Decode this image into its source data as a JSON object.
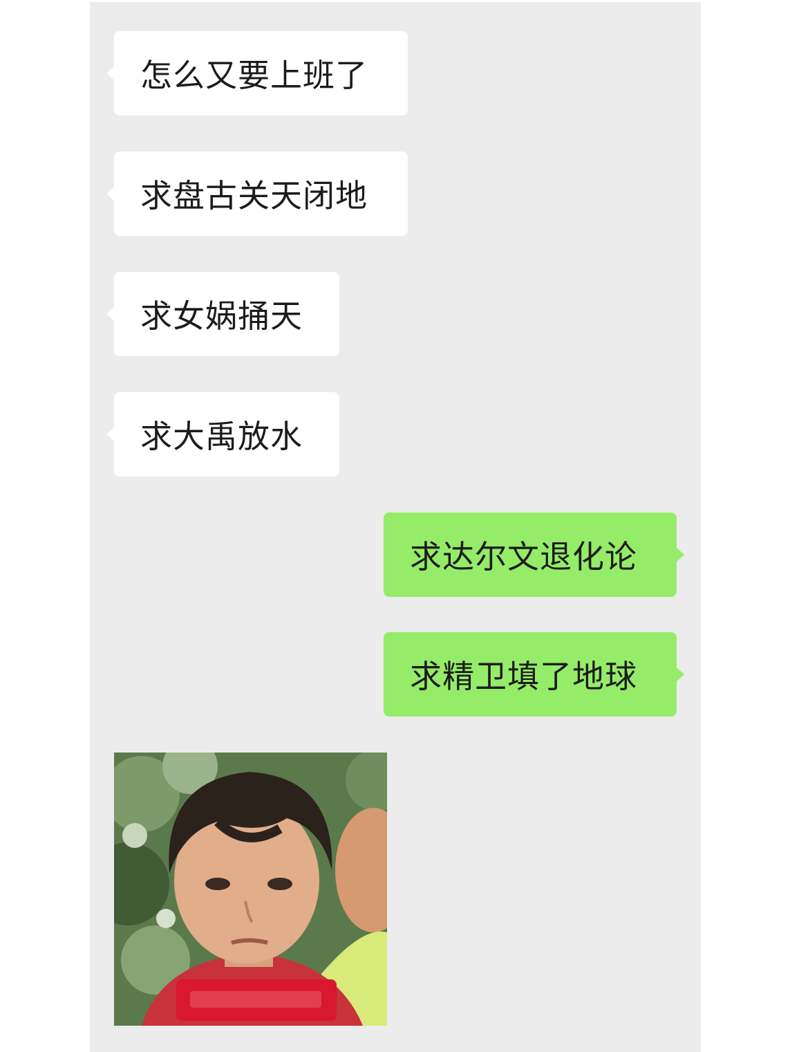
{
  "messages": [
    {
      "side": "incoming",
      "text": "怎么又要上班了"
    },
    {
      "side": "incoming",
      "text": "求盘古关天闭地"
    },
    {
      "side": "incoming",
      "text": "求女娲捅天"
    },
    {
      "side": "incoming",
      "text": "求大禹放水"
    },
    {
      "side": "outgoing",
      "text": "求达尔文退化论"
    },
    {
      "side": "outgoing",
      "text": "求精卫填了地球"
    }
  ],
  "sticker": {
    "side": "incoming",
    "description_icon": "sad-boy-sticker-image"
  },
  "colors": {
    "chat_background": "#ececec",
    "incoming_bubble": "#ffffff",
    "outgoing_bubble": "#95ec69",
    "text": "#1c1c1c"
  }
}
